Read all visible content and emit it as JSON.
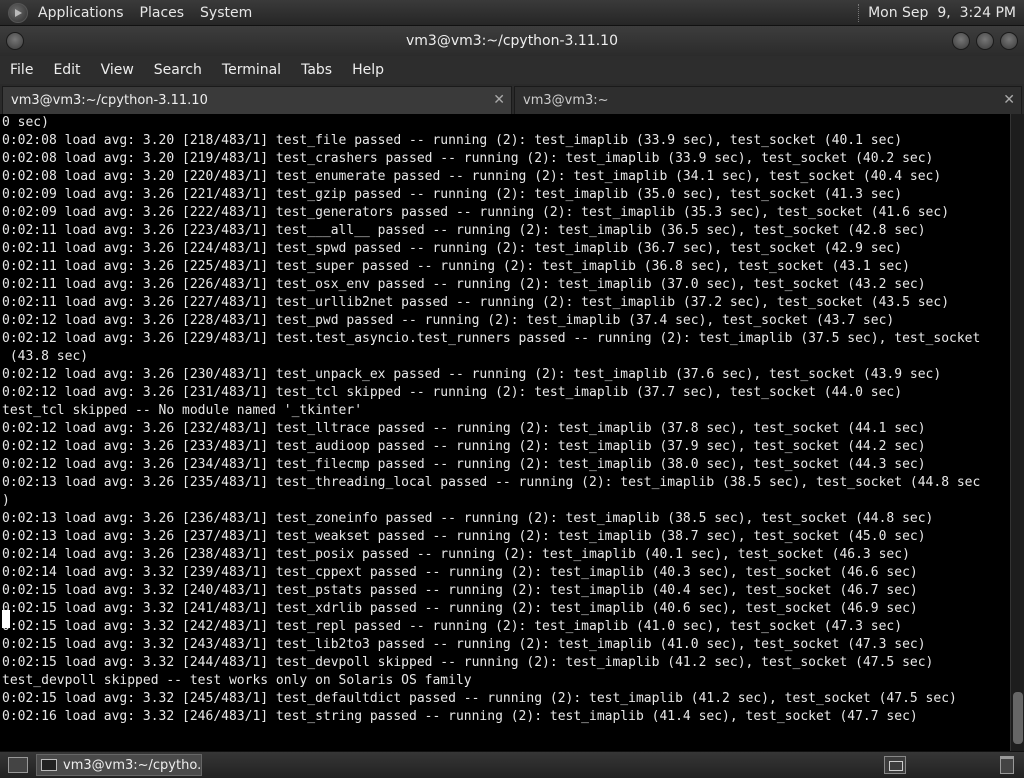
{
  "top_panel": {
    "menus": [
      "Applications",
      "Places",
      "System"
    ],
    "clock": "Mon Sep  9,  3:24 PM"
  },
  "window": {
    "title": "vm3@vm3:~/cpython-3.11.10"
  },
  "menubar": [
    "File",
    "Edit",
    "View",
    "Search",
    "Terminal",
    "Tabs",
    "Help"
  ],
  "tabs": [
    {
      "label": "vm3@vm3:~/cpython-3.11.10",
      "close": "✕"
    },
    {
      "label": "vm3@vm3:~",
      "close": "✕"
    }
  ],
  "terminal_lines": [
    "0 sec)",
    "0:02:08 load avg: 3.20 [218/483/1] test_file passed -- running (2): test_imaplib (33.9 sec), test_socket (40.1 sec)",
    "0:02:08 load avg: 3.20 [219/483/1] test_crashers passed -- running (2): test_imaplib (33.9 sec), test_socket (40.2 sec)",
    "0:02:08 load avg: 3.20 [220/483/1] test_enumerate passed -- running (2): test_imaplib (34.1 sec), test_socket (40.4 sec)",
    "0:02:09 load avg: 3.26 [221/483/1] test_gzip passed -- running (2): test_imaplib (35.0 sec), test_socket (41.3 sec)",
    "0:02:09 load avg: 3.26 [222/483/1] test_generators passed -- running (2): test_imaplib (35.3 sec), test_socket (41.6 sec)",
    "0:02:11 load avg: 3.26 [223/483/1] test___all__ passed -- running (2): test_imaplib (36.5 sec), test_socket (42.8 sec)",
    "0:02:11 load avg: 3.26 [224/483/1] test_spwd passed -- running (2): test_imaplib (36.7 sec), test_socket (42.9 sec)",
    "0:02:11 load avg: 3.26 [225/483/1] test_super passed -- running (2): test_imaplib (36.8 sec), test_socket (43.1 sec)",
    "0:02:11 load avg: 3.26 [226/483/1] test_osx_env passed -- running (2): test_imaplib (37.0 sec), test_socket (43.2 sec)",
    "0:02:11 load avg: 3.26 [227/483/1] test_urllib2net passed -- running (2): test_imaplib (37.2 sec), test_socket (43.5 sec)",
    "0:02:12 load avg: 3.26 [228/483/1] test_pwd passed -- running (2): test_imaplib (37.4 sec), test_socket (43.7 sec)",
    "0:02:12 load avg: 3.26 [229/483/1] test.test_asyncio.test_runners passed -- running (2): test_imaplib (37.5 sec), test_socket",
    " (43.8 sec)",
    "0:02:12 load avg: 3.26 [230/483/1] test_unpack_ex passed -- running (2): test_imaplib (37.6 sec), test_socket (43.9 sec)",
    "0:02:12 load avg: 3.26 [231/483/1] test_tcl skipped -- running (2): test_imaplib (37.7 sec), test_socket (44.0 sec)",
    "test_tcl skipped -- No module named '_tkinter'",
    "0:02:12 load avg: 3.26 [232/483/1] test_lltrace passed -- running (2): test_imaplib (37.8 sec), test_socket (44.1 sec)",
    "0:02:12 load avg: 3.26 [233/483/1] test_audioop passed -- running (2): test_imaplib (37.9 sec), test_socket (44.2 sec)",
    "0:02:12 load avg: 3.26 [234/483/1] test_filecmp passed -- running (2): test_imaplib (38.0 sec), test_socket (44.3 sec)",
    "0:02:13 load avg: 3.26 [235/483/1] test_threading_local passed -- running (2): test_imaplib (38.5 sec), test_socket (44.8 sec",
    ")",
    "0:02:13 load avg: 3.26 [236/483/1] test_zoneinfo passed -- running (2): test_imaplib (38.5 sec), test_socket (44.8 sec)",
    "0:02:13 load avg: 3.26 [237/483/1] test_weakset passed -- running (2): test_imaplib (38.7 sec), test_socket (45.0 sec)",
    "0:02:14 load avg: 3.26 [238/483/1] test_posix passed -- running (2): test_imaplib (40.1 sec), test_socket (46.3 sec)",
    "0:02:14 load avg: 3.32 [239/483/1] test_cppext passed -- running (2): test_imaplib (40.3 sec), test_socket (46.6 sec)",
    "0:02:15 load avg: 3.32 [240/483/1] test_pstats passed -- running (2): test_imaplib (40.4 sec), test_socket (46.7 sec)",
    "0:02:15 load avg: 3.32 [241/483/1] test_xdrlib passed -- running (2): test_imaplib (40.6 sec), test_socket (46.9 sec)",
    "0:02:15 load avg: 3.32 [242/483/1] test_repl passed -- running (2): test_imaplib (41.0 sec), test_socket (47.3 sec)",
    "0:02:15 load avg: 3.32 [243/483/1] test_lib2to3 passed -- running (2): test_imaplib (41.0 sec), test_socket (47.3 sec)",
    "0:02:15 load avg: 3.32 [244/483/1] test_devpoll skipped -- running (2): test_imaplib (41.2 sec), test_socket (47.5 sec)",
    "test_devpoll skipped -- test works only on Solaris OS family",
    "0:02:15 load avg: 3.32 [245/483/1] test_defaultdict passed -- running (2): test_imaplib (41.2 sec), test_socket (47.5 sec)",
    "0:02:16 load avg: 3.32 [246/483/1] test_string passed -- running (2): test_imaplib (41.4 sec), test_socket (47.7 sec)"
  ],
  "taskbar": {
    "task_label": "vm3@vm3:~/cpytho..."
  }
}
